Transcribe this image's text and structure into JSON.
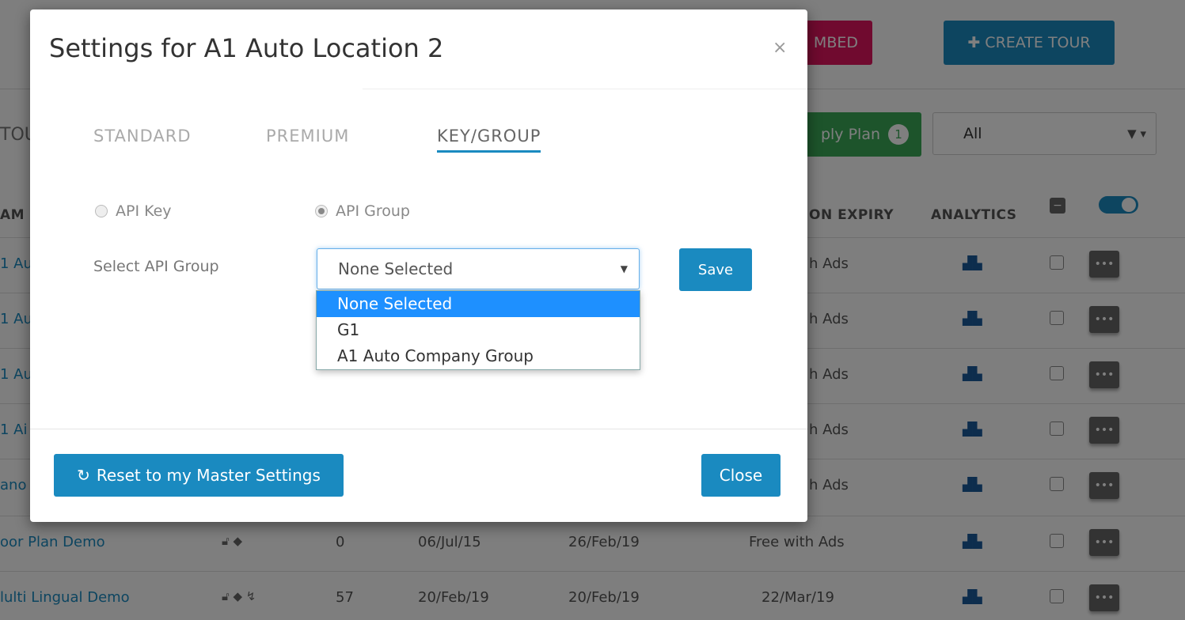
{
  "background": {
    "embed_button": "MBED",
    "create_tour_button": "CREATE TOUR",
    "tours_label": "TOU",
    "apply_plan_button": "ply Plan",
    "apply_plan_badge": "1",
    "filter_value": "All",
    "columns": {
      "name": "AM",
      "expiry": "ON EXPIRY",
      "analytics": "ANALYTICS"
    },
    "rows": [
      {
        "name": "1 Au",
        "expiry": "h Ads"
      },
      {
        "name": "1 Au",
        "expiry": "h Ads"
      },
      {
        "name": "1 Au",
        "expiry": "h Ads"
      },
      {
        "name": "1 Ai",
        "expiry": "h Ads"
      },
      {
        "name": "ano",
        "expiry": "h Ads"
      },
      {
        "name": "oor Plan Demo",
        "count": "0",
        "created": "06/Jul/15",
        "updated": "26/Feb/19",
        "expiry": "Free with Ads"
      },
      {
        "name": "lulti Lingual Demo",
        "count": "57",
        "created": "20/Feb/19",
        "updated": "20/Feb/19",
        "expiry": "22/Mar/19"
      }
    ]
  },
  "modal": {
    "title": "Settings for A1 Auto Location 2",
    "close_x": "×",
    "tabs": [
      {
        "label": "STANDARD"
      },
      {
        "label": "PREMIUM"
      },
      {
        "label": "KEY/GROUP"
      }
    ],
    "radios": {
      "api_key": "API Key",
      "api_group": "API Group"
    },
    "select_label": "Select API Group",
    "select_value": "None Selected",
    "dropdown_options": [
      "None Selected",
      "G1",
      "A1 Auto Company Group"
    ],
    "save_button": "Save",
    "reset_button": "Reset to my Master Settings",
    "close_button": "Close"
  },
  "colors": {
    "primary": "#1a8ac0",
    "embed": "#e0155f",
    "apply": "#3aa857",
    "dropdown_highlight": "#1e90ff"
  },
  "icons": [
    "plus-icon",
    "filter-icon",
    "refresh-icon",
    "analytics-icon",
    "lock-icon",
    "tag-icon"
  ]
}
